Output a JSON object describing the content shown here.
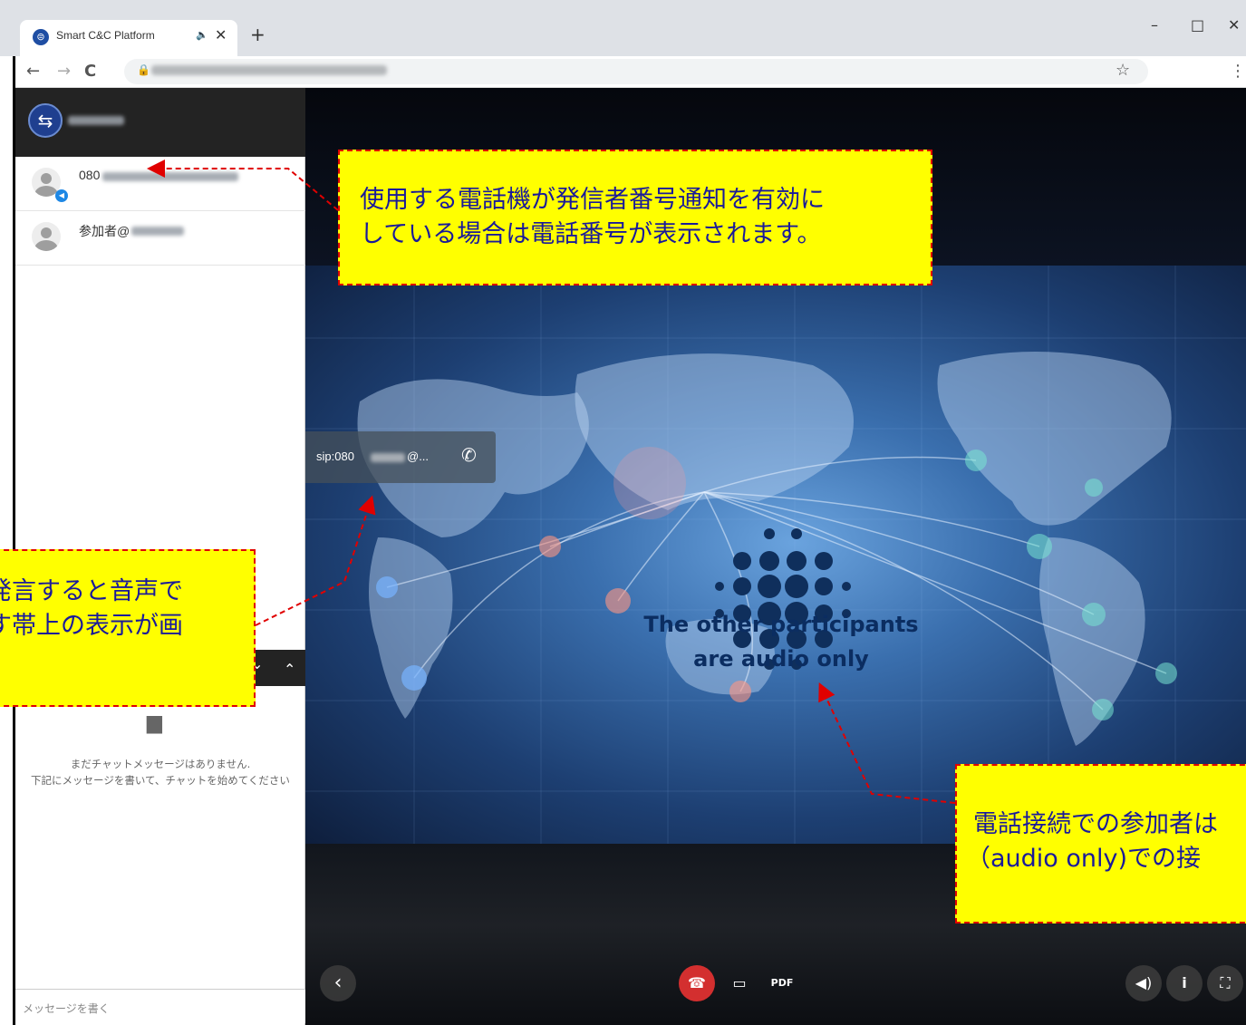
{
  "browser": {
    "tab_title": "Smart C&C Platform",
    "tab_audio_icon": "speaker-icon",
    "tab_close": "✕",
    "new_tab": "+",
    "back": "←",
    "forward": "→",
    "reload": "C",
    "star": "☆",
    "menu": "⋮",
    "minimize": "–",
    "maximize": "□",
    "close": "✕"
  },
  "sidebar": {
    "participants": [
      {
        "name_prefix": "080",
        "audio_badge": true
      },
      {
        "name_prefix": "参加者@",
        "audio_badge": false
      }
    ],
    "chat": {
      "empty_line1": "まだチャットメッセージはありません.",
      "empty_line2": "下記にメッセージを書いて、チャットを始めてください",
      "input_placeholder": "メッセージを書く",
      "collapse_chevron": "⌄",
      "expand_chevron": "⌃"
    }
  },
  "video": {
    "sip_label": "sip:080",
    "sip_suffix": "@...",
    "audio_only_line1": "The other participants",
    "audio_only_line2": "are audio only"
  },
  "controls": {
    "prev": "‹",
    "hangup_icon": "hangup-icon",
    "screen_icon": "monitor-icon",
    "pdf_icon": "pdf-icon",
    "volume_icon": "volume-icon",
    "info_icon": "info-icon",
    "fullscreen_icon": "fullscreen-icon"
  },
  "annotations": {
    "top_line1": "使用する電話機が発信者番号通知を有効に",
    "top_line2": "している場合は電話番号が表示されます。",
    "left_line1": "発言すると音声で",
    "left_line2": "す帯上の表示が画",
    "right_line1": "電話接続での参加者は",
    "right_line2": "（audio only)での接"
  },
  "colors": {
    "accent": "#1e88e5",
    "hangup": "#d32f2f",
    "callout_bg": "#ffff00",
    "callout_border": "#e00000",
    "callout_text": "#1a1a9a"
  }
}
